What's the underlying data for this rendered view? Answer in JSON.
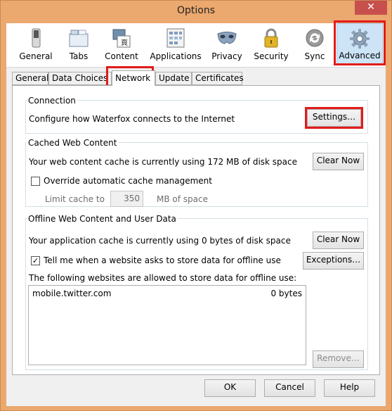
{
  "window": {
    "title": "Options",
    "close_glyph": "✕"
  },
  "toolbar": {
    "items": [
      {
        "label": "General",
        "icon": "switch-icon"
      },
      {
        "label": "Tabs",
        "icon": "tabs-icon"
      },
      {
        "label": "Content",
        "icon": "content-icon"
      },
      {
        "label": "Applications",
        "icon": "applications-icon"
      },
      {
        "label": "Privacy",
        "icon": "privacy-mask-icon"
      },
      {
        "label": "Security",
        "icon": "lock-icon"
      },
      {
        "label": "Sync",
        "icon": "sync-icon"
      },
      {
        "label": "Advanced",
        "icon": "gear-icon"
      }
    ],
    "selected": "Advanced"
  },
  "tabs": [
    "General",
    "Data Choices",
    "Network",
    "Update",
    "Certificates"
  ],
  "active_tab": "Network",
  "connection": {
    "heading": "Connection",
    "description": "Configure how Waterfox connects to the Internet",
    "settings_label": "Settings…"
  },
  "cache": {
    "heading": "Cached Web Content",
    "usage_text": "Your web content cache is currently using 172 MB of disk space",
    "clear_label": "Clear Now",
    "override_label": "Override automatic cache management",
    "override_checked": false,
    "limit_label": "Limit cache to",
    "limit_value": "350",
    "limit_unit": "MB of space"
  },
  "offline": {
    "heading": "Offline Web Content and User Data",
    "usage_text": "Your application cache is currently using 0 bytes of disk space",
    "clear_label": "Clear Now",
    "tell_label": "Tell me when a website asks to store data for offline use",
    "tell_checked": true,
    "exceptions_label": "Exceptions…",
    "allowed_label": "The following websites are allowed to store data for offline use:",
    "sites": [
      {
        "site": "mobile.twitter.com",
        "size": "0 bytes"
      }
    ],
    "remove_label": "Remove…"
  },
  "dialog_buttons": {
    "ok": "OK",
    "cancel": "Cancel",
    "help": "Help"
  },
  "colors": {
    "highlight": "#e21b1b",
    "selected_bg": "#cde4f7",
    "titlebar": "#eba86f"
  }
}
